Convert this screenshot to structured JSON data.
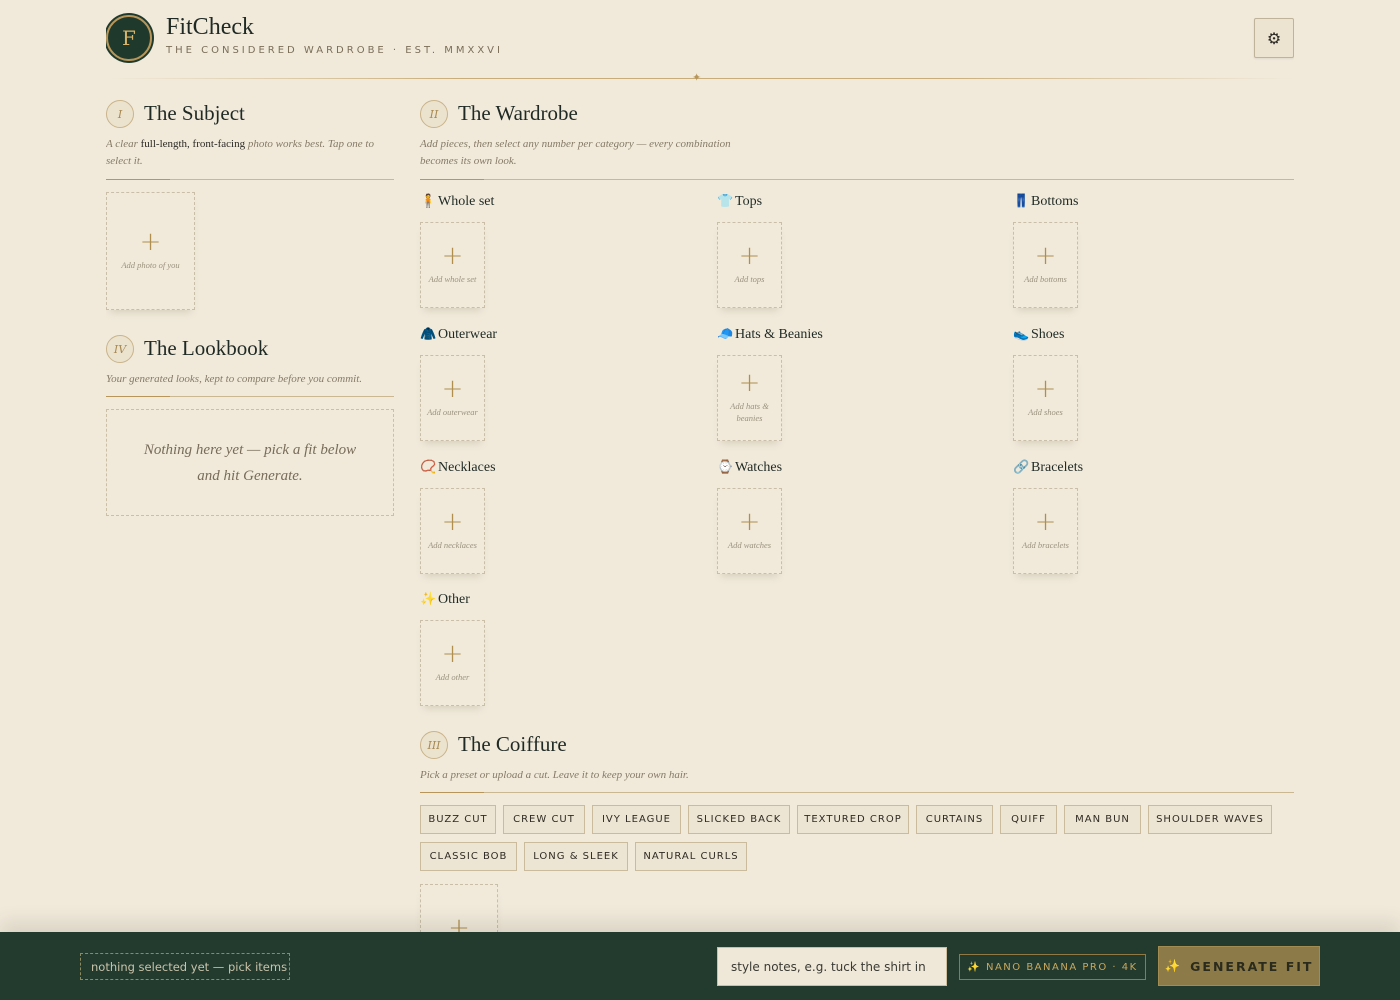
{
  "header": {
    "logo_letter": "F",
    "title": "FitCheck",
    "tagline": "THE CONSIDERED WARDROBE · EST. MMXXVI",
    "settings_icon": "⚙",
    "divider_glyph": "✦"
  },
  "subject": {
    "numeral": "I",
    "title": "The Subject",
    "sub_pre": "A clear ",
    "sub_bold": "full-length, front-facing",
    "sub_post": " photo works best. Tap one to select it.",
    "add_label": "Add photo of you"
  },
  "lookbook": {
    "numeral": "IV",
    "title": "The Lookbook",
    "subtitle": "Your generated looks, kept to compare before you commit.",
    "empty_line1": "Nothing here yet — pick a fit below",
    "empty_line2": "and hit Generate."
  },
  "wardrobe": {
    "numeral": "II",
    "title": "The Wardrobe",
    "subtitle": "Add pieces, then select any number per category — every combination becomes its own look.",
    "categories": [
      {
        "icon": "🧍",
        "label": "Whole set",
        "add": "Add whole set"
      },
      {
        "icon": "👕",
        "label": "Tops",
        "add": "Add tops"
      },
      {
        "icon": "👖",
        "label": "Bottoms",
        "add": "Add bottoms"
      },
      {
        "icon": "🧥",
        "label": "Outerwear",
        "add": "Add outerwear"
      },
      {
        "icon": "🧢",
        "label": "Hats & Beanies",
        "add": "Add hats & beanies"
      },
      {
        "icon": "👟",
        "label": "Shoes",
        "add": "Add shoes"
      },
      {
        "icon": "📿",
        "label": "Necklaces",
        "add": "Add necklaces"
      },
      {
        "icon": "⌚",
        "label": "Watches",
        "add": "Add watches"
      },
      {
        "icon": "🔗",
        "label": "Bracelets",
        "add": "Add bracelets"
      },
      {
        "icon": "✨",
        "label": "Other",
        "add": "Add other"
      }
    ]
  },
  "coiffure": {
    "numeral": "III",
    "title": "The Coiffure",
    "subtitle": "Pick a preset or upload a cut. Leave it to keep your own hair.",
    "presets": [
      "BUZZ CUT",
      "CREW CUT",
      "IVY LEAGUE",
      "SLICKED BACK",
      "TEXTURED CROP",
      "CURTAINS",
      "QUIFF",
      "MAN BUN",
      "SHOULDER WAVES",
      "CLASSIC BOB",
      "LONG & SLEEK",
      "NATURAL CURLS"
    ]
  },
  "bottom_bar": {
    "status": "nothing selected yet — pick items or",
    "notes_placeholder": "style notes, e.g. tuck the shirt in",
    "model": "✨ NANO BANANA PRO · 4K",
    "generate_icon": "✨",
    "generate": "GENERATE FIT"
  },
  "colors": {
    "background": "#f1eadb",
    "accent_gold": "#b8965a",
    "forest_green": "#233a2f"
  }
}
